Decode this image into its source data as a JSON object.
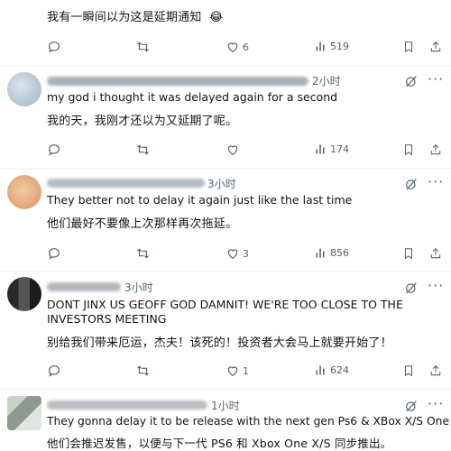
{
  "top_post": {
    "translation": "我有一瞬间以为这是延期通知",
    "emoji": "😂",
    "actions": {
      "reply": "",
      "retweet": "",
      "like": "6",
      "views": "519"
    }
  },
  "replies": [
    {
      "username_partial": "...hadSAwesome1...",
      "time": "2小时",
      "text": "my god i thought it was delayed again for a second",
      "translation": "我的天，我刚才还以为又延期了呢。",
      "actions": {
        "reply": "",
        "retweet": "",
        "like": "",
        "views": "174"
      }
    },
    {
      "time": "3小时",
      "text": "They better not to delay it again just like the last time",
      "translation": "他们最好不要像上次那样再次拖延。",
      "actions": {
        "reply": "",
        "retweet": "",
        "like": "3",
        "views": "856"
      }
    },
    {
      "time": "3小时",
      "text_line1": "DONT JINX US GEOFF GOD DAMNIT! WE'RE TOO CLOSE TO THE",
      "text_line2": "INVESTORS MEETING",
      "translation": "别给我们带来厄运，杰夫！该死的！投资者大会马上就要开始了！",
      "actions": {
        "reply": "",
        "retweet": "",
        "like": "1",
        "views": "624"
      }
    },
    {
      "time": "1小时",
      "text": "They gonna delay it to be release with the next gen Ps6 & XBox X/S One",
      "translation": "他们会推迟发售，以便与下一代 PS6 和 Xbox One X/S 同步推出。"
    }
  ],
  "colors": {
    "text": "#0f1419",
    "secondary": "#536471",
    "divider": "#eff3f4"
  },
  "icons": [
    "reply-icon",
    "retweet-icon",
    "like-icon",
    "views-icon",
    "bookmark-icon",
    "share-icon",
    "grok-icon",
    "more-icon"
  ]
}
